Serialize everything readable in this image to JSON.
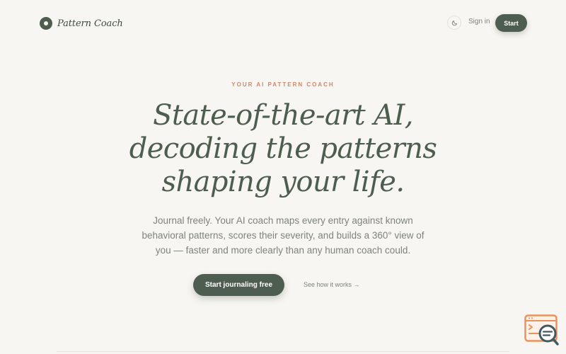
{
  "header": {
    "brand": "Pattern Coach",
    "theme_toggle_icon": "moon-icon",
    "sign_in": "Sign in",
    "start": "Start"
  },
  "hero": {
    "eyebrow": "YOUR AI PATTERN COACH",
    "headline_lines": [
      "State-of-the-art AI,",
      "decoding the patterns",
      "shaping your life."
    ],
    "subhead_lines": [
      "Journal freely. Your AI coach maps every entry against known",
      "behavioral patterns, scores their severity, and builds a 360° view of",
      "you — faster and more clearly than any human coach could."
    ],
    "cta_primary": "Start journaling free",
    "cta_secondary": "See how it works →"
  },
  "widget": {
    "icon": "search-document-icon"
  },
  "colors": {
    "background": "#f8f6f2",
    "primary": "#4d5d4f",
    "eyebrow": "#d0866a",
    "muted_text": "#7d837c"
  }
}
